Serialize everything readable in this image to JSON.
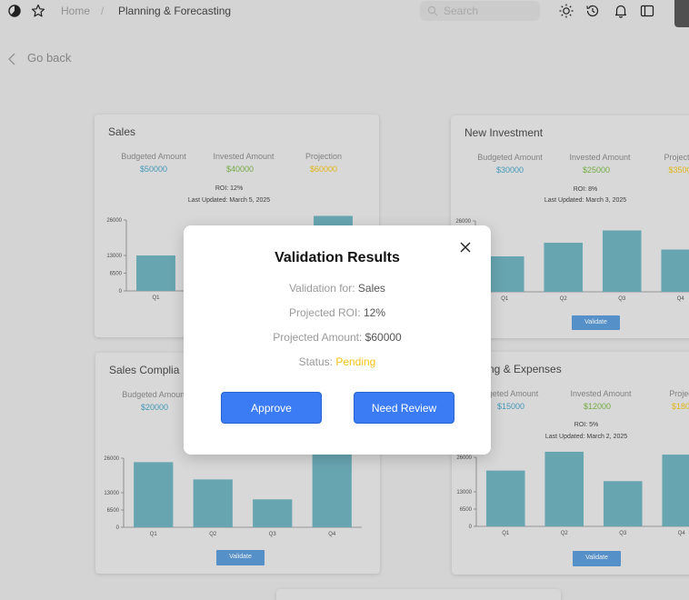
{
  "topbar": {
    "breadcrumb_home": "Home",
    "breadcrumb_sep": "/",
    "breadcrumb_current": "Planning & Forecasting",
    "search_placeholder": "Search",
    "icons": [
      "pie-chart-icon",
      "star-icon",
      "search-icon",
      "sun-icon",
      "history-icon",
      "bell-icon",
      "sidebar-toggle-icon"
    ]
  },
  "goback": {
    "label": "Go back",
    "icon": "chevron-left-icon"
  },
  "colors": {
    "budgeted": "#4aa3c4",
    "invested": "#7ab648",
    "projection": "#f0c21b",
    "bar": "#6eb0bd",
    "accent": "#3b7cf4",
    "pending": "#f2c21b"
  },
  "cards": [
    {
      "title": "Sales",
      "labels": {
        "budgeted": "Budgeted Amount",
        "invested": "Invested Amount",
        "projection": "Projection"
      },
      "values": {
        "budgeted": "$50000",
        "invested": "$40000",
        "projection": "$60000"
      },
      "roi": "ROI: 12%",
      "updated": "Last Updated: March 5, 2025",
      "chart_data": {
        "type": "bar",
        "categories": [
          "Q1",
          "Q2",
          "Q3",
          "Q4"
        ],
        "values": [
          13000,
          0,
          0,
          27500
        ],
        "y_ticks": [
          "26000",
          "13000",
          "6500",
          "0"
        ],
        "ylim": [
          0,
          26000
        ]
      }
    },
    {
      "title": "New Investment",
      "labels": {
        "budgeted": "Budgeted Amount",
        "invested": "Invested Amount",
        "projection": "Projectio"
      },
      "values": {
        "budgeted": "$30000",
        "invested": "$25000",
        "projection": "$3500"
      },
      "roi": "ROI: 8%",
      "updated": "Last Updated: March 3, 2025",
      "validate": "Validate",
      "chart_data": {
        "type": "bar",
        "categories": [
          "Q1",
          "Q2",
          "Q3",
          "Q4"
        ],
        "values": [
          13000,
          18000,
          22500,
          15500
        ],
        "y_ticks": [
          "26000",
          "13000",
          "6500",
          "0"
        ],
        "ylim": [
          0,
          26000
        ]
      }
    },
    {
      "title": "Sales Complia",
      "labels": {
        "budgeted": "Budgeted Amount"
      },
      "values": {
        "budgeted": "$20000"
      },
      "validate": "Validate",
      "chart_data": {
        "type": "bar",
        "categories": [
          "Q1",
          "Q2",
          "Q3",
          "Q4"
        ],
        "values": [
          24500,
          18000,
          10500,
          28000
        ],
        "y_ticks": [
          "26000",
          "13000",
          "6500",
          "0"
        ],
        "ylim": [
          0,
          26000
        ]
      }
    },
    {
      "title": "eling & Expenses",
      "labels": {
        "budgeted": "dgeted Amount",
        "invested": "Invested Amount",
        "projection": "Projec"
      },
      "values": {
        "budgeted": "$15000",
        "invested": "$12000",
        "projection": "$180"
      },
      "roi": "ROI: 5%",
      "updated": "Last Updated: March 2, 2025",
      "validate": "Validate",
      "chart_data": {
        "type": "bar",
        "categories": [
          "Q1",
          "Q2",
          "Q3",
          "Q4"
        ],
        "values": [
          21000,
          29000,
          17000,
          27000
        ],
        "y_ticks": [
          "26000",
          "13000",
          "6500",
          "0"
        ],
        "ylim": [
          0,
          26000
        ]
      }
    }
  ],
  "modal": {
    "title": "Validation Results",
    "row1_label": "Validation for: ",
    "row1_value": "Sales",
    "row2_label": "Projected ROI: ",
    "row2_value": "12%",
    "row3_label": "Projected Amount: ",
    "row3_value": "$60000",
    "row4_label": "Status: ",
    "row4_value": "Pending",
    "approve": "Approve",
    "review": "Need Review"
  }
}
